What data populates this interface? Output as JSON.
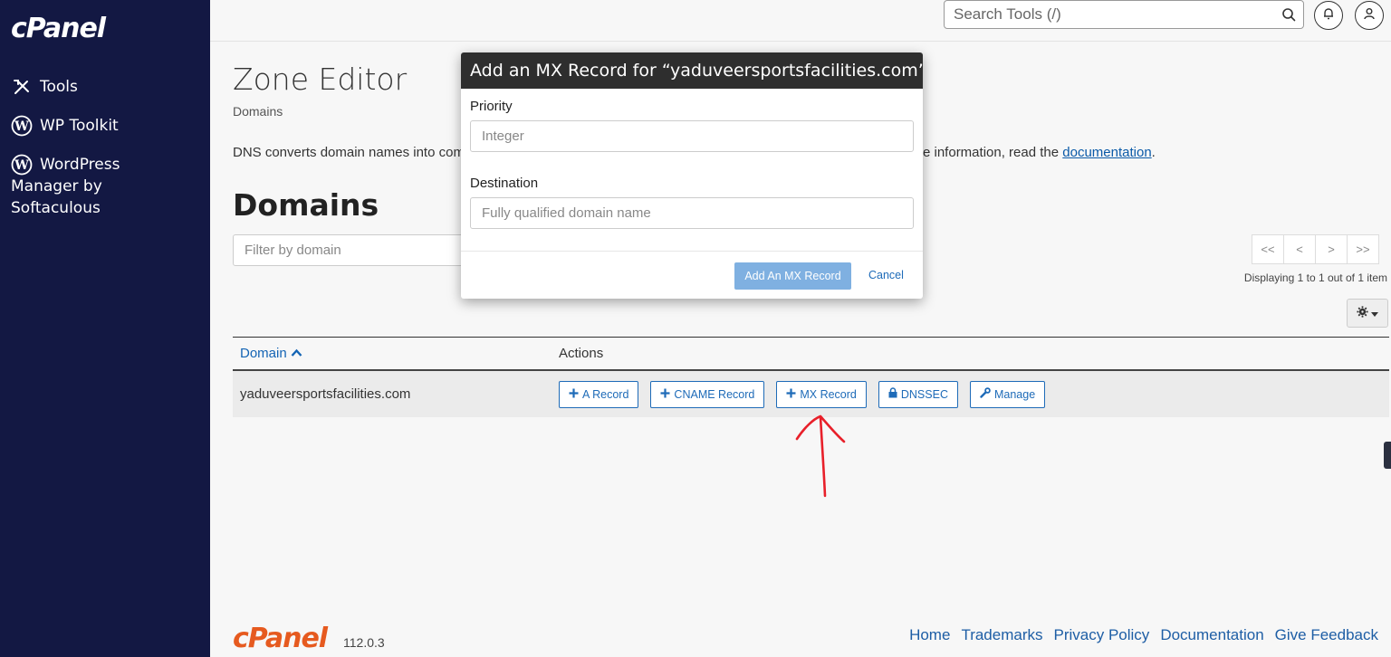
{
  "sidebar": {
    "logo": "cPanel",
    "items": [
      {
        "label": "Tools",
        "icon": "tools-icon"
      },
      {
        "label": "WP Toolkit",
        "icon": "wordpress-icon"
      },
      {
        "label": "WordPress",
        "label_line2": "Manager by",
        "label_line3": "Softaculous",
        "icon": "wordpress-icon"
      }
    ]
  },
  "topbar": {
    "search_placeholder": "Search Tools (/)",
    "search_icon": "search-icon",
    "notifications_icon": "bell-icon",
    "user_icon": "user-icon"
  },
  "main": {
    "title": "Zone Editor",
    "breadcrumb": "Domains",
    "description_left": "DNS converts domain names into com",
    "description_right": "re information, read the ",
    "documentation_link": "documentation",
    "description_end": ".",
    "section_title": "Domains",
    "filter_placeholder": "Filter by domain",
    "pager": [
      "<<",
      "<",
      ">",
      ">>"
    ],
    "displaying": "Displaying 1 to 1 out of 1 item",
    "table": {
      "columns": [
        "Domain",
        "Actions"
      ],
      "rows": [
        {
          "domain": "yaduveersportsfacilities.com",
          "actions": [
            "A Record",
            "CNAME Record",
            "MX Record",
            "DNSSEC",
            "Manage"
          ]
        }
      ]
    }
  },
  "modal": {
    "title": "Add an MX Record for “yaduveersportsfacilities.com”",
    "priority_label": "Priority",
    "priority_placeholder": "Integer",
    "destination_label": "Destination",
    "destination_placeholder": "Fully qualified domain name",
    "submit_label": "Add An MX Record",
    "cancel_label": "Cancel"
  },
  "footer": {
    "logo": "cPanel",
    "version": "112.0.3",
    "links": [
      "Home",
      "Trademarks",
      "Privacy Policy",
      "Documentation",
      "Give Feedback"
    ]
  },
  "colors": {
    "sidebar_bg": "#131843",
    "accent": "#1e6bb8",
    "primary_button": "#7fb0e1",
    "modal_header": "#2e2e2e",
    "brand_orange": "#e65a1f",
    "annotation_red": "#e8202a"
  }
}
